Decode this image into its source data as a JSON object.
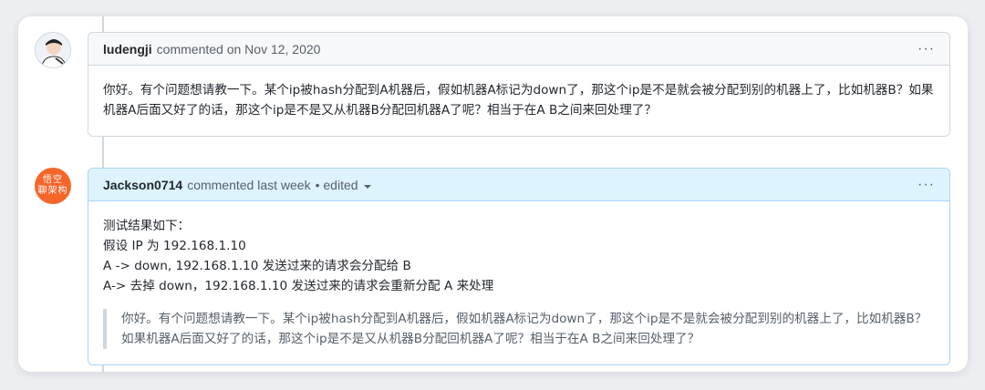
{
  "comments": [
    {
      "author": "ludengji",
      "meta": "commented on Nov 12, 2020",
      "menu_icon": "···",
      "body": "你好。有个问题想请教一下。某个ip被hash分配到A机器后，假如机器A标记为down了，那这个ip是不是就会被分配到别的机器上了，比如机器B？如果机器A后面又好了的话，那这个ip是不是又从机器B分配回机器A了呢？相当于在A B之间来回处理了？"
    },
    {
      "author": "Jackson0714",
      "meta": "commented last week",
      "edited": "• edited",
      "menu_icon": "···",
      "avatar_text": [
        "悟空",
        "聊架构"
      ],
      "lines": [
        "测试结果如下：",
        "假设 IP 为 192.168.1.10",
        "A -> down, 192.168.1.10 发送过来的请求会分配给 B",
        "A-> 去掉 down，192.168.1.10 发送过来的请求会重新分配 A 来处理"
      ],
      "quote": "你好。有个问题想请教一下。某个ip被hash分配到A机器后，假如机器A标记为down了，那这个ip是不是就会被分配到别的机器上了，比如机器B？如果机器A后面又好了的话，那这个ip是不是又从机器B分配回机器A了呢？相当于在A B之间来回处理了？"
    }
  ],
  "colors": {
    "page_bg": "#eceef1",
    "header_bg": "#f6f8fa",
    "highlight_header_bg": "#ddf4ff",
    "avatar_orange": "#f4662a"
  }
}
